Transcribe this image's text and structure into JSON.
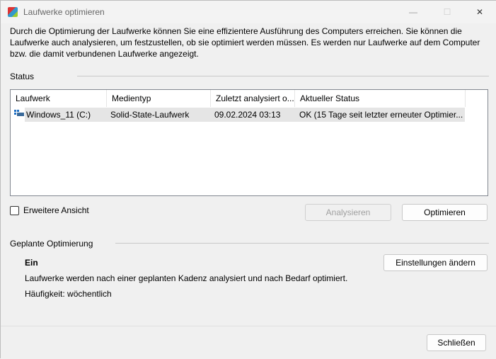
{
  "window": {
    "title": "Laufwerke optimieren",
    "minimize": "—",
    "maximize": "☐",
    "close": "✕"
  },
  "intro": "Durch die Optimierung der Laufwerke können Sie eine effizientere Ausführung des Computers erreichen. Sie können die Laufwerke auch analysieren, um festzustellen, ob sie optimiert werden müssen. Es werden nur Laufwerke auf dem Computer bzw. die damit verbundenen Laufwerke angezeigt.",
  "status": {
    "heading": "Status",
    "columns": [
      "Laufwerk",
      "Medientyp",
      "Zuletzt analysiert o...",
      "Aktueller Status"
    ],
    "rows": [
      {
        "drive": "Windows_11 (C:)",
        "media": "Solid-State-Laufwerk",
        "last": "09.02.2024 03:13",
        "state": "OK (15 Tage seit letzter erneuter Optimier..."
      }
    ]
  },
  "advanced_view": "Erweitere Ansicht",
  "analyze": "Analysieren",
  "optimize": "Optimieren",
  "scheduled": {
    "heading": "Geplante Optimierung",
    "state": "Ein",
    "description": "Laufwerke werden nach einer geplanten Kadenz analysiert und nach Bedarf optimiert.",
    "frequency": "Häufigkeit: wöchentlich",
    "change_settings": "Einstellungen ändern"
  },
  "close": "Schließen"
}
